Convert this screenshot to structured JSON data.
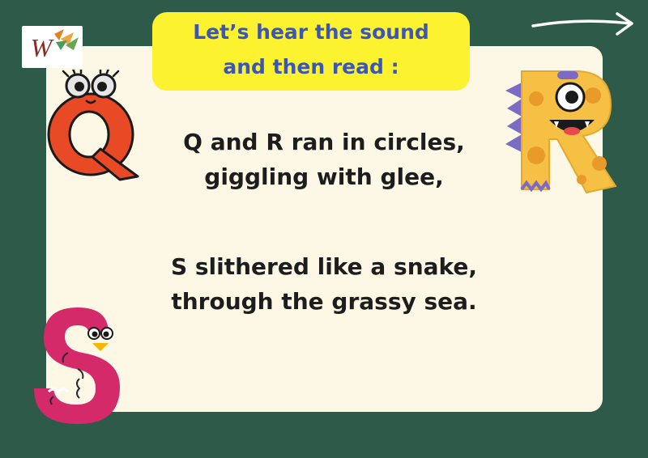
{
  "banner": {
    "line1": "Let’s hear the sound",
    "line2": "and then read :"
  },
  "poem": {
    "stanza1": [
      "Q and R ran in circles,",
      "giggling with glee,"
    ],
    "stanza2": [
      "S slithered like a snake,",
      "through the grassy sea."
    ]
  },
  "logo": {
    "mark": "W"
  },
  "decorations": {
    "letters": [
      "Q",
      "R",
      "S"
    ],
    "icons": [
      "next-arrow-icon",
      "letter-q-character",
      "letter-r-monster",
      "letter-s-character"
    ]
  },
  "colors": {
    "background": "#2e5a4a",
    "card": "#fdf8e6",
    "banner": "#fcf230",
    "banner_text": "#3a56b8",
    "q_letter": "#e84a26",
    "r_letter": "#f5c044",
    "s_letter": "#d42a6a"
  }
}
